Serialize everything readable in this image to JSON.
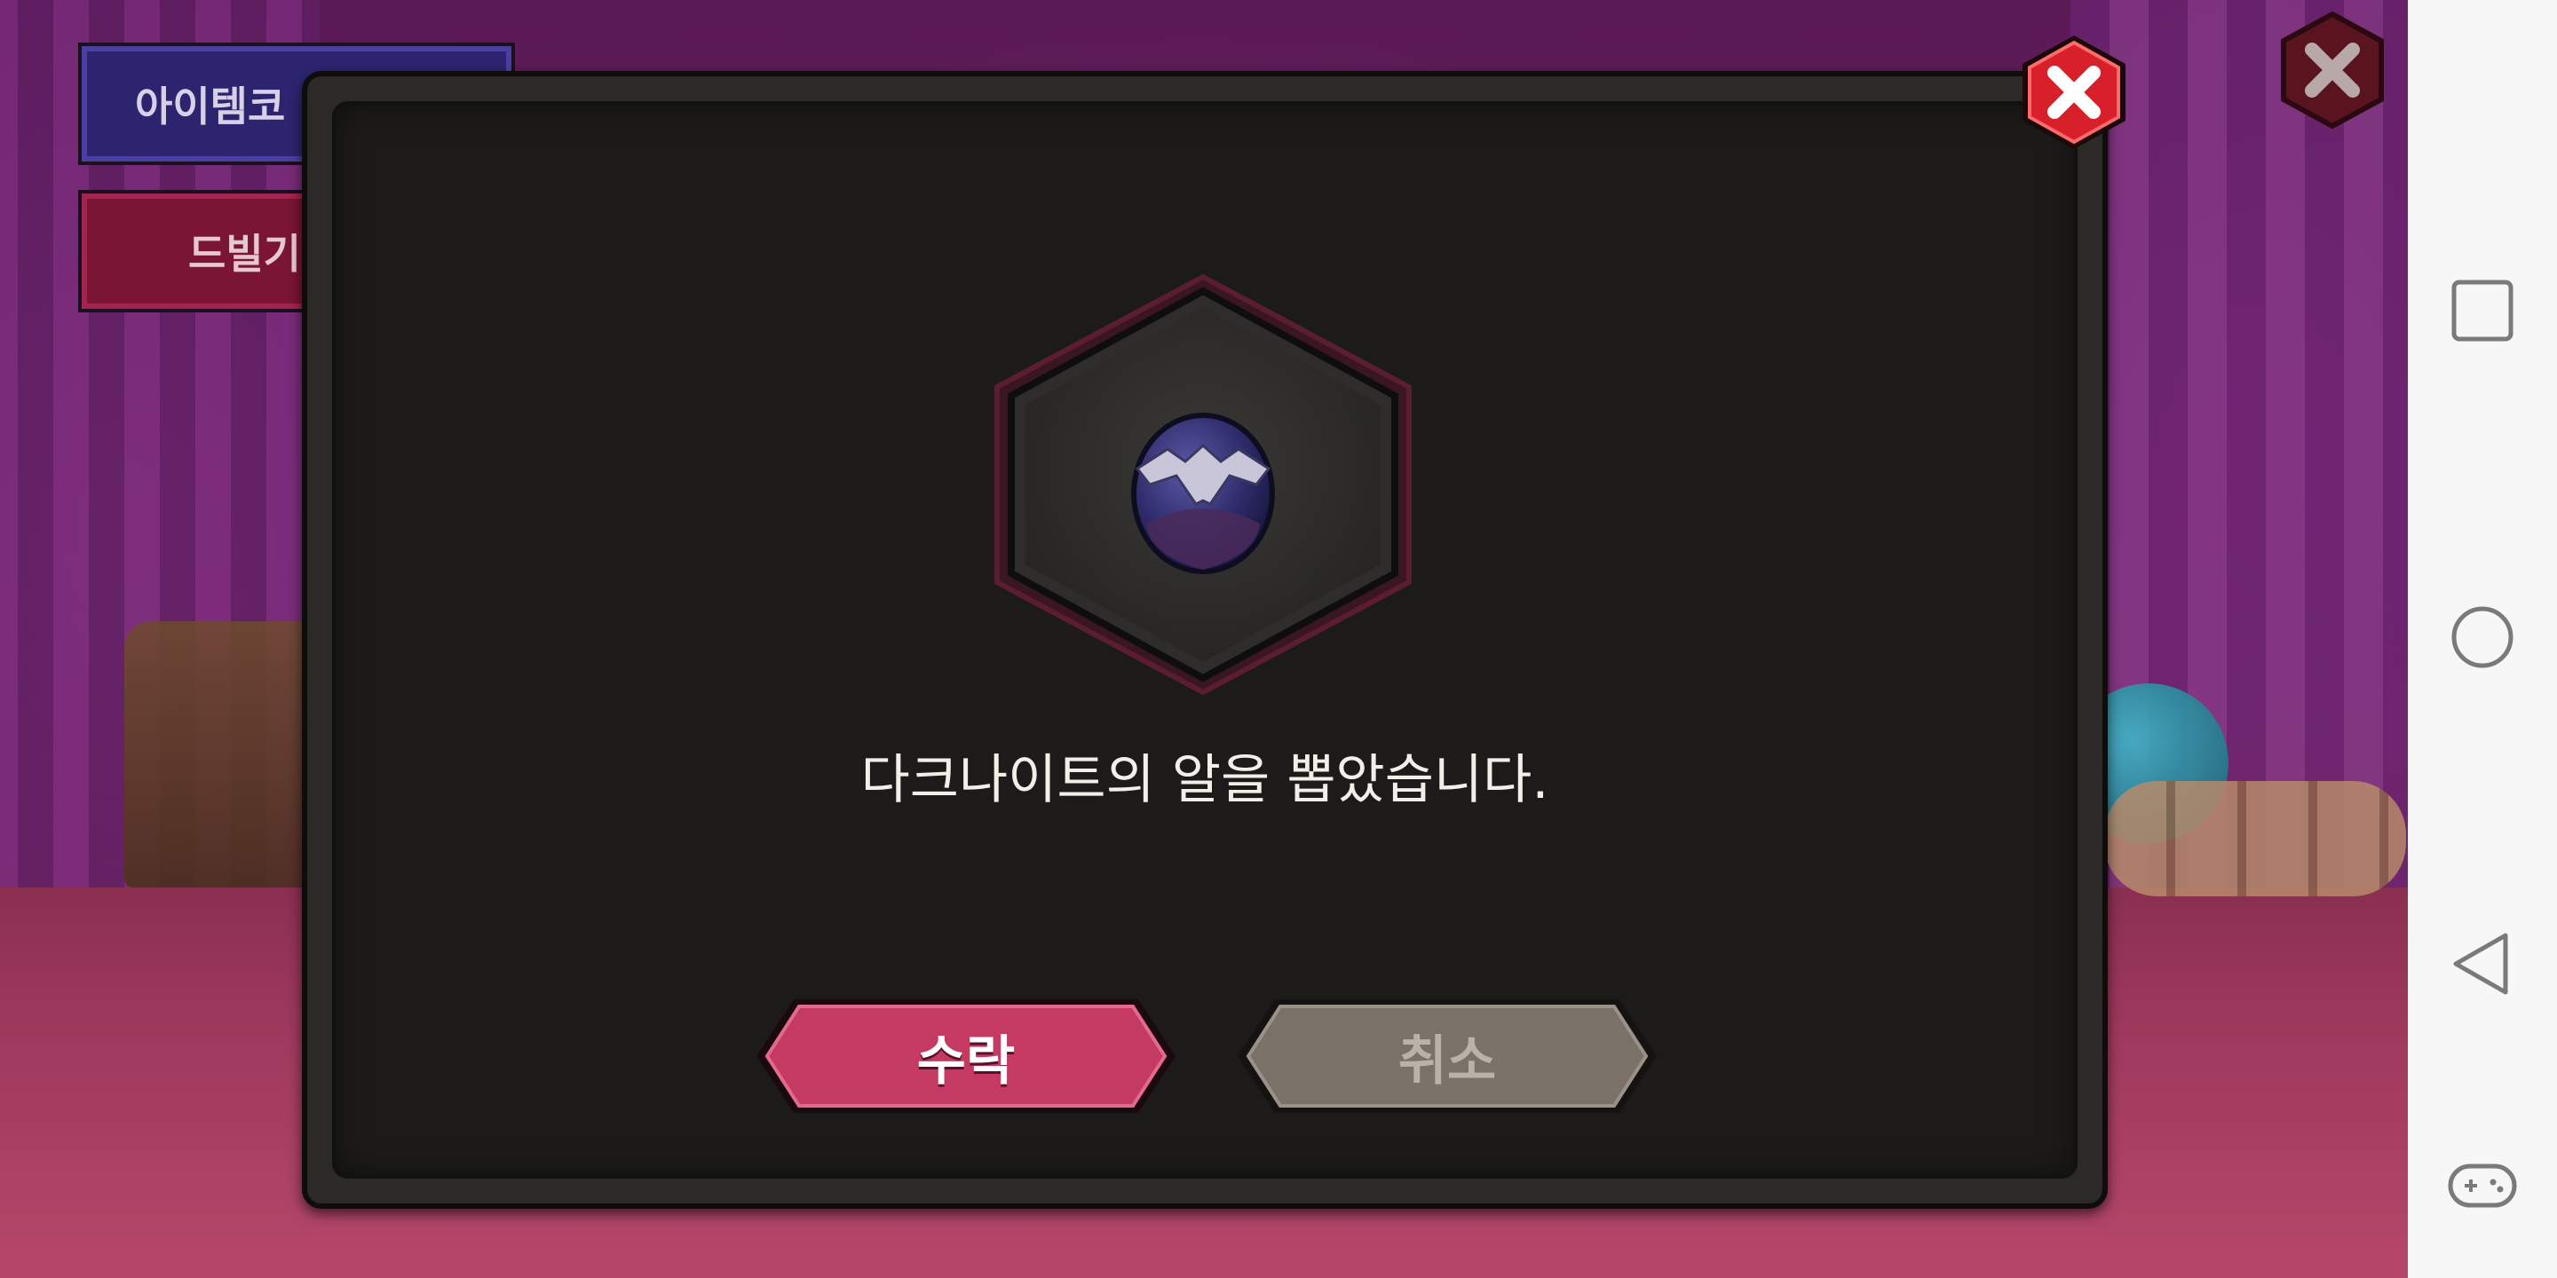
{
  "background": {
    "item_button_label": "아이템코",
    "dribble_button_label": "드빌기"
  },
  "dialog": {
    "message": "다크나이트의 알을 뽑았습니다.",
    "reward_icon": "dark-knight-egg-icon",
    "accept_label": "수락",
    "cancel_label": "취소",
    "close_icon": "close-icon"
  },
  "navbar": {
    "icons": [
      "recent-apps-icon",
      "home-icon",
      "back-icon",
      "game-controller-icon"
    ]
  },
  "colors": {
    "accept": "#c53a62",
    "cancel": "#7a7268",
    "close": "#d7202a",
    "dialog_bg": "#1c1b19"
  }
}
